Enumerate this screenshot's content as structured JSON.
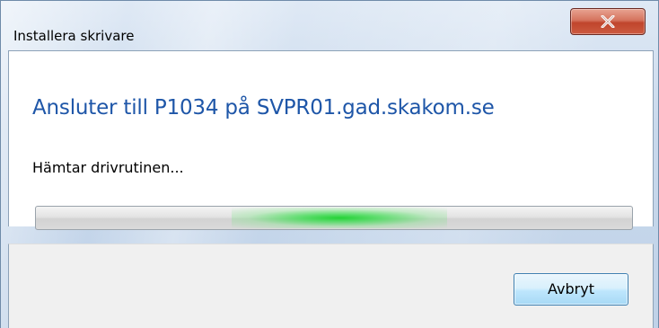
{
  "window": {
    "title": "Installera skrivare",
    "close_icon": "close-x-icon"
  },
  "content": {
    "main_instruction": "Ansluter till P1034 på SVPR01.gad.skakom.se",
    "status": "Hämtar drivrutinen...",
    "progress": {
      "style": "marquee",
      "glow_color": "#24d236"
    }
  },
  "footer": {
    "cancel_label": "Avbryt"
  },
  "colors": {
    "instruction_blue": "#1e56a8",
    "close_red": "#c0452c",
    "frame": "#c9d9ec"
  }
}
